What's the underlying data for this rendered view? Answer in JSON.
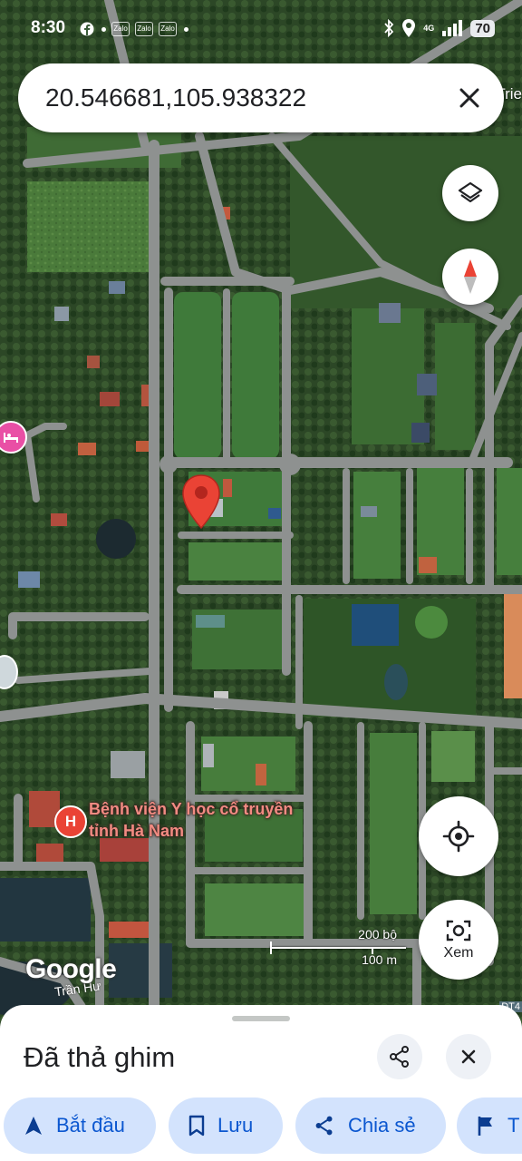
{
  "status_bar": {
    "time": "8:30",
    "app_icons": [
      "facebook-icon",
      "Zalo",
      "Zalo",
      "Zalo"
    ],
    "network": "4G",
    "battery": "70"
  },
  "search": {
    "query": "20.546681,105.938322",
    "close_icon": "close-icon"
  },
  "map": {
    "poi_label": "Bệnh viện Y học cổ truyền tỉnh Hà Nam",
    "poi_icon": "H",
    "edge_label": "Trie",
    "edge_label_bottom": "DT4",
    "street_label": "Trần Hư",
    "watermark": "Google",
    "scale": {
      "imperial": "200 bộ",
      "metric": "100 m"
    },
    "lens_label": "Xem",
    "pin_color": "#ea4335",
    "hotel_color": "#e94fa5"
  },
  "sheet": {
    "title": "Đã thả ghim",
    "chips": {
      "start": "Bắt đầu",
      "save": "Lưu",
      "share": "Chia sẻ",
      "more": "T"
    }
  },
  "colors": {
    "chip_bg": "#d3e3fd",
    "chip_text": "#0b57d0"
  }
}
